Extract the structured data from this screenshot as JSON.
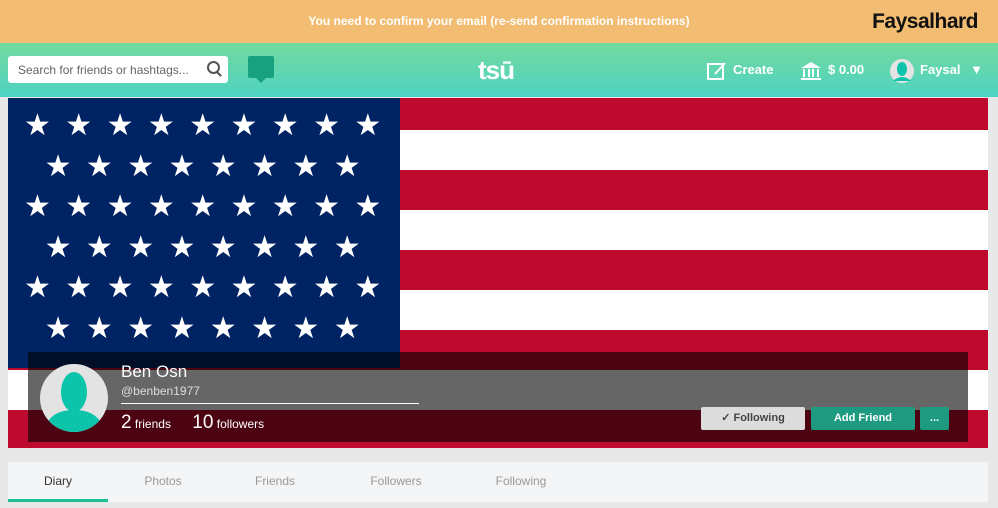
{
  "banner": {
    "message": "You need to confirm your email (re-send confirmation instructions)",
    "brand": "Faysalhard"
  },
  "nav": {
    "search_placeholder": "Search for friends or hashtags...",
    "logo": "tsū",
    "create": "Create",
    "balance": "$ 0.00",
    "user": "Faysal"
  },
  "profile": {
    "name": "Ben Osn",
    "handle": "@benben1977",
    "friends_count": "2",
    "friends_label": "friends",
    "followers_count": "10",
    "followers_label": "followers"
  },
  "actions": {
    "following": "✓ Following",
    "add_friend": "Add Friend",
    "more": "..."
  },
  "tabs": [
    {
      "label": "Diary"
    },
    {
      "label": "Photos"
    },
    {
      "label": "Friends"
    },
    {
      "label": "Followers"
    },
    {
      "label": "Following"
    }
  ],
  "colors": {
    "banner": "#f2bd72",
    "accent": "#1fbf95",
    "flag_red": "#bf0a30",
    "flag_blue": "#002463"
  }
}
